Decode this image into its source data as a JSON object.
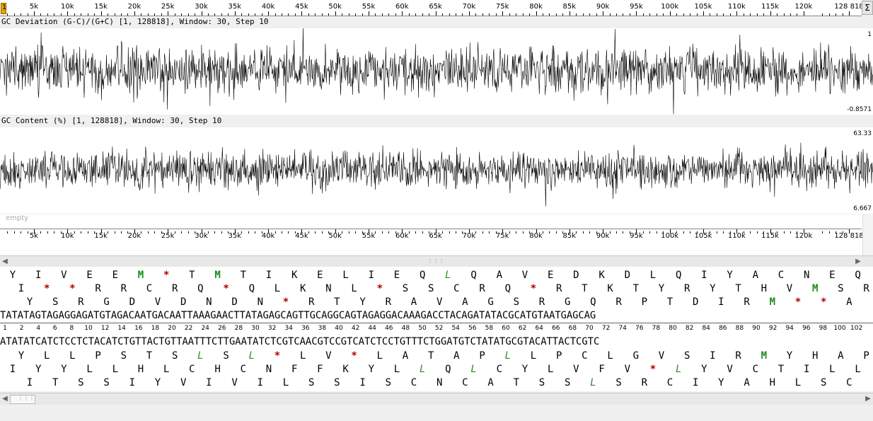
{
  "top_ruler": {
    "labels": [
      "5k",
      "10k",
      "15k",
      "20k",
      "25k",
      "30k",
      "35k",
      "40k",
      "45k",
      "50k",
      "55k",
      "60k",
      "65k",
      "70k",
      "75k",
      "80k",
      "85k",
      "90k",
      "95k",
      "100k",
      "105k",
      "110k",
      "115k",
      "120k",
      "128 818"
    ],
    "start_label": "1",
    "sigma_label": "Σ"
  },
  "gc_deviation": {
    "title": "GC Deviation (G-C)/(G+C) [1, 128818], Window: 30, Step 10",
    "max_label": "1",
    "min_label": "-0.8571"
  },
  "gc_content": {
    "title": "GC Content (%) [1, 128818], Window: 30, Step 10",
    "max_label": "63.33",
    "min_label": "6.667"
  },
  "empty_track": {
    "label": "empty"
  },
  "bottom_ruler": {
    "labels": [
      "5k",
      "10k",
      "15k",
      "20k",
      "25k",
      "30k",
      "35k",
      "40k",
      "45k",
      "50k",
      "55k",
      "60k",
      "65k",
      "70k",
      "75k",
      "80k",
      "85k",
      "90k",
      "95k",
      "100k",
      "105k",
      "110k",
      "115k",
      "120k",
      "128 818"
    ]
  },
  "sequence_view": {
    "frame1": "Y I V E E M * T M T I K E L I E Q L Q A V E D K D L Q I Y A C N E Q",
    "frame2": "I * * R R C R Q * Q L K N L * S S C R Q * R T K T Y R Y T H V M S R",
    "frame3": "Y S R G D V D N D N * R T Y R A V A G S R G Q R P T D I R M * * A",
    "forward": "TATATAGTAGAGGAGATGTAGACAATGACAATTAAAGAACTTATAGAGCAGTTGCAGGCAGTAGAGGACAAAGACCTACAGATATACGCATGTAATGAGCAG",
    "position_labels": [
      "1",
      "2",
      "4",
      "6",
      "8",
      "10",
      "12",
      "14",
      "16",
      "18",
      "20",
      "22",
      "24",
      "26",
      "28",
      "30",
      "32",
      "34",
      "36",
      "38",
      "40",
      "42",
      "44",
      "46",
      "48",
      "50",
      "52",
      "54",
      "56",
      "58",
      "60",
      "62",
      "64",
      "66",
      "68",
      "70",
      "72",
      "74",
      "76",
      "78",
      "80",
      "82",
      "84",
      "86",
      "88",
      "90",
      "92",
      "94",
      "96",
      "98",
      "100",
      "102"
    ],
    "reverse": "ATATATCATCTCCTCTACATCTGTTACTGTTAATTTCTTGAATATCTCGTCAACGTCCGTCATCTCCTGTTTCTGGATGTCTATATGCGTACATTACTCGTC",
    "rframe1": "Y L L P S T S L S L * L V * L A T A P L L P C L G V S I R M Y H A P",
    "rframe2": "I Y Y L L H L C H C N F F K Y L L Q L C Y L V F V * L Y V C T I L L",
    "rframe3": "I T S S I Y V I V I L S S I S C N C A T S S L S R C I Y A H L S C"
  },
  "colors": {
    "start_codon": "#1b8a1b",
    "stop_codon": "#b00000",
    "alt_start": "#2a8f2a"
  }
}
